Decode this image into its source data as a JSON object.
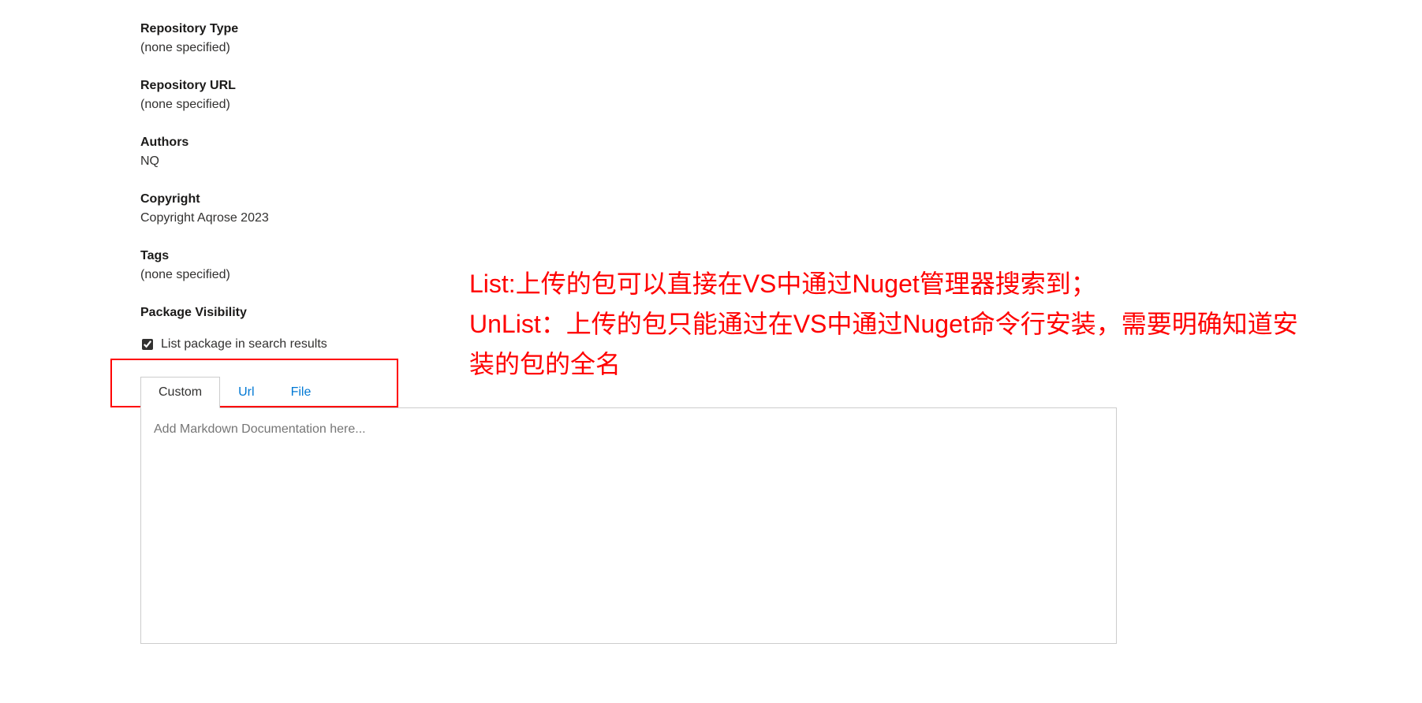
{
  "fields": {
    "repository_type": {
      "label": "Repository Type",
      "value": "(none specified)"
    },
    "repository_url": {
      "label": "Repository URL",
      "value": "(none specified)"
    },
    "authors": {
      "label": "Authors",
      "value": "NQ"
    },
    "copyright": {
      "label": "Copyright",
      "value": "Copyright Aqrose 2023"
    },
    "tags": {
      "label": "Tags",
      "value": "(none specified)"
    }
  },
  "visibility": {
    "label": "Package Visibility",
    "checkbox_label": "List package in search results",
    "checked": true
  },
  "tabs": {
    "custom": "Custom",
    "url": "Url",
    "file": "File",
    "active": "custom"
  },
  "textarea": {
    "placeholder": "Add Markdown Documentation here...",
    "value": ""
  },
  "annotation": {
    "line1": "List:上传的包可以直接在VS中通过Nuget管理器搜索到；",
    "line2": "UnList：上传的包只能通过在VS中通过Nuget命令行安装，需要明确知道安装的包的全名"
  }
}
